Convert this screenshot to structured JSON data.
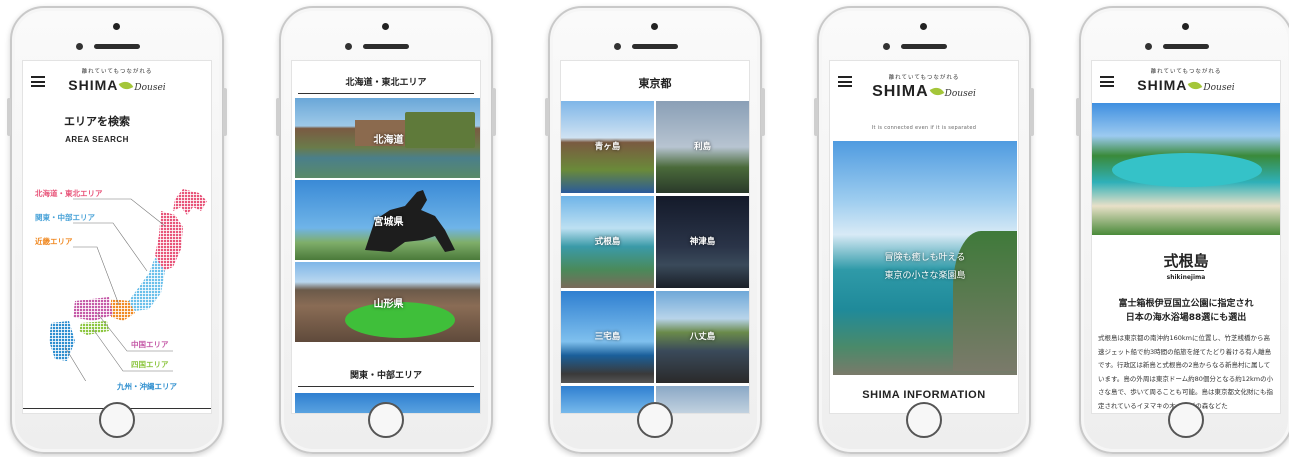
{
  "phones": {
    "area": {
      "brand": {
        "tagline": "離れていてもつながれる",
        "name": "SHIMA",
        "script": "Dousei"
      },
      "title": "エリアを検索",
      "subtitle": "AREA SEARCH",
      "regions": [
        {
          "label": "北海道・東北エリア",
          "color": "#e8557a"
        },
        {
          "label": "関東・中部エリア",
          "color": "#4aa3d8"
        },
        {
          "label": "近畿エリア",
          "color": "#f08a24"
        },
        {
          "label": "中国エリア",
          "color": "#c55aa8"
        },
        {
          "label": "四国エリア",
          "color": "#8cc63f"
        },
        {
          "label": "九州・沖縄エリア",
          "color": "#2f8fcf"
        }
      ]
    },
    "prefectures": {
      "section1": "北海道・東北エリア",
      "tiles": [
        "北海道",
        "宮城県",
        "山形県"
      ],
      "section2": "関東・中部エリア"
    },
    "tokyo": {
      "title": "東京都",
      "islands": [
        "青ヶ島",
        "利島",
        "式根島",
        "神津島",
        "三宅島",
        "八丈島"
      ]
    },
    "home": {
      "brand": {
        "tagline": "離れていてもつながれる",
        "name": "SHIMA",
        "script": "Dousei"
      },
      "caption": "It is connected even if it is separated",
      "hero_line1": "冒険も癒しも叶える",
      "hero_line2": "東京の小さな楽園島",
      "info_title": "SHIMA INFORMATION"
    },
    "detail": {
      "brand": {
        "tagline": "離れていてもつながれる",
        "name": "SHIMA",
        "script": "Dousei"
      },
      "island_name": "式根島",
      "island_roman": "shikinejima",
      "headline1": "富士箱根伊豆国立公園に指定され",
      "headline2": "日本の海水浴場88選にも選出",
      "body": "式根島は東京都の南沖約160kmに位置し、竹芝桟橋から高速ジェット船で約3時間の船旅を経てたどり着ける有人離島です。行政区は新島と式根島の2島からなる新島村に属しています。島の外周は東京ドーム約80個分となる約12kmの小さな島で、歩いて周ることも可能。島は東京都文化財にも指定されているイヌマキの木・ナギの森などた"
    }
  }
}
